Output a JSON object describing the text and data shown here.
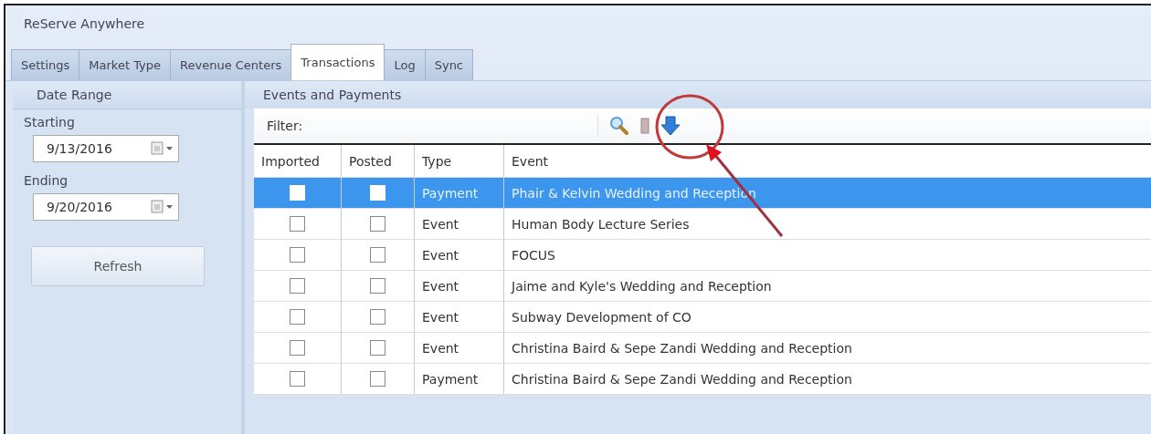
{
  "window": {
    "title": "ReServe Anywhere"
  },
  "tabs": [
    {
      "label": "Settings",
      "selected": false
    },
    {
      "label": "Market Type",
      "selected": false
    },
    {
      "label": "Revenue Centers",
      "selected": false
    },
    {
      "label": "Transactions",
      "selected": true
    },
    {
      "label": "Log",
      "selected": false
    },
    {
      "label": "Sync",
      "selected": false
    }
  ],
  "date_range": {
    "title": "Date Range",
    "starting_label": "Starting",
    "starting_value": "9/13/2016",
    "ending_label": "Ending",
    "ending_value": "9/20/2016",
    "refresh_button": "Refresh"
  },
  "events_panel": {
    "title": "Events and Payments",
    "filter_label": "Filter:",
    "columns": [
      "Imported",
      "Posted",
      "Type",
      "Event"
    ],
    "rows": [
      {
        "imported": false,
        "posted": false,
        "type": "Payment",
        "event": "Phair & Kelvin Wedding and Reception",
        "selected": true
      },
      {
        "imported": false,
        "posted": false,
        "type": "Event",
        "event": "Human Body Lecture Series",
        "selected": false
      },
      {
        "imported": false,
        "posted": false,
        "type": "Event",
        "event": "FOCUS",
        "selected": false
      },
      {
        "imported": false,
        "posted": false,
        "type": "Event",
        "event": "Jaime and Kyle's Wedding and Reception",
        "selected": false
      },
      {
        "imported": false,
        "posted": false,
        "type": "Event",
        "event": "Subway Development of CO",
        "selected": false
      },
      {
        "imported": false,
        "posted": false,
        "type": "Event",
        "event": "Christina Baird & Sepe Zandi Wedding and Reception",
        "selected": false
      },
      {
        "imported": false,
        "posted": false,
        "type": "Payment",
        "event": "Christina Baird & Sepe Zandi Wedding and Reception",
        "selected": false
      }
    ]
  }
}
